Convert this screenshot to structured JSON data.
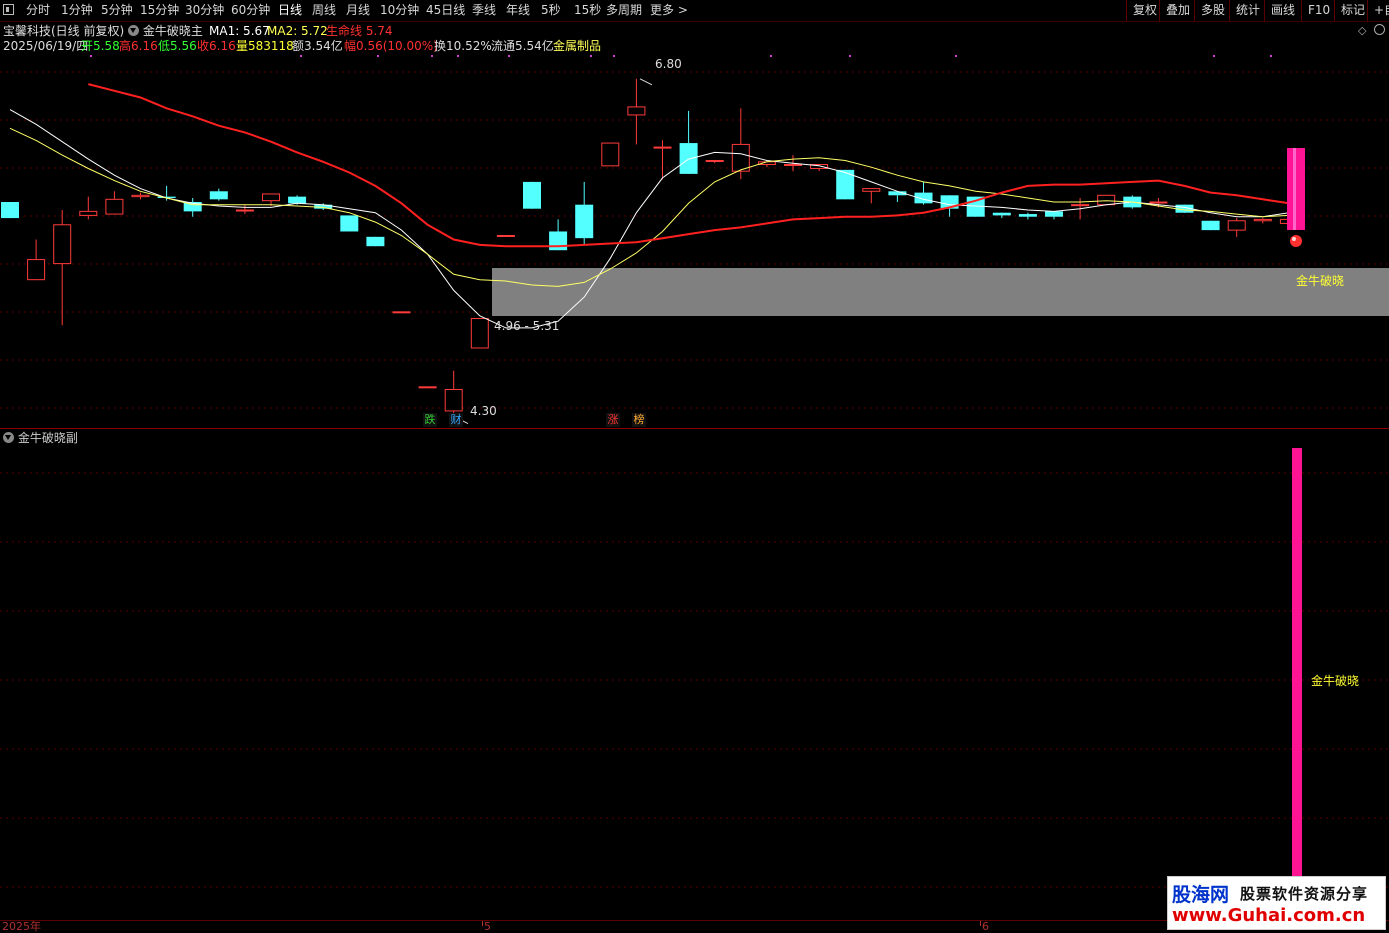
{
  "toolbar": {
    "periods": [
      "分时",
      "1分钟",
      "5分钟",
      "15分钟",
      "30分钟",
      "60分钟",
      "日线",
      "周线",
      "月线",
      "10分钟",
      "45日线",
      "季线",
      "年线",
      "5秒",
      "15秒",
      "多周期",
      "更多 >"
    ],
    "active_period": "日线",
    "right_tools": [
      "复权",
      "叠加",
      "多股",
      "统计",
      "画线",
      "F10",
      "标记",
      "+自"
    ]
  },
  "header": {
    "stock_name": "宝馨科技",
    "mode": "(日线 前复权)",
    "formula_name": "金牛破晓主",
    "ma1_label": "MA1: 5.67",
    "ma2_label": "MA2: 5.72",
    "life_line_label": "生命线  5.74"
  },
  "quote": {
    "date": "2025/06/19/四",
    "open": "开5.58",
    "high": "高6.16",
    "low": "低5.56",
    "close": "收6.16",
    "volume": "量583118",
    "amount": "额3.54亿",
    "change": "幅0.56(10.00%)",
    "turnover": "换10.52%",
    "float": "流通5.54亿",
    "industry": "金属制品"
  },
  "annotations": {
    "high_price": "6.80",
    "low_price": "4.30",
    "zone_range": "4.96 - 5.31",
    "signal_label": "金牛破晓",
    "sub_signal_label": "金牛破晓"
  },
  "signals": [
    {
      "text": "跌",
      "color": "#33cc33"
    },
    {
      "text": "财",
      "color": "#33aaff"
    },
    {
      "text": "涨",
      "color": "#ff3333"
    },
    {
      "text": "榜",
      "color": "#ffaa33"
    }
  ],
  "sub_panel": {
    "title": "金牛破晓副"
  },
  "time_axis": {
    "labels": [
      "2025年",
      "5",
      "6"
    ]
  },
  "watermark": {
    "logo": "股海网",
    "slogan": "股票软件资源分享",
    "url": "www.Guhai.com.cn"
  },
  "colors": {
    "up": "#ff3b3b",
    "down": "#54ffff",
    "ma_white": "#ffffff",
    "ma_yellow": "#ffff66",
    "life_line": "#ff2020",
    "signal_magenta": "#ff1493"
  },
  "chart_data": {
    "type": "candlestick",
    "ylim": [
      4.2,
      7.0
    ],
    "candles": [
      {
        "o": 5.88,
        "h": 5.88,
        "l": 5.76,
        "c": 5.76
      },
      {
        "o": 5.3,
        "h": 5.6,
        "l": 5.3,
        "c": 5.45
      },
      {
        "o": 5.42,
        "h": 5.82,
        "l": 4.96,
        "c": 5.71
      },
      {
        "o": 5.78,
        "h": 5.92,
        "l": 5.75,
        "c": 5.81
      },
      {
        "o": 5.79,
        "h": 5.96,
        "l": 5.79,
        "c": 5.9
      },
      {
        "o": 5.92,
        "h": 5.95,
        "l": 5.9,
        "c": 5.93
      },
      {
        "o": 5.92,
        "h": 6.0,
        "l": 5.89,
        "c": 5.91
      },
      {
        "o": 5.88,
        "h": 5.91,
        "l": 5.77,
        "c": 5.81
      },
      {
        "o": 5.96,
        "h": 5.98,
        "l": 5.89,
        "c": 5.9
      },
      {
        "o": 5.82,
        "h": 5.86,
        "l": 5.79,
        "c": 5.82
      },
      {
        "o": 5.89,
        "h": 5.94,
        "l": 5.85,
        "c": 5.94
      },
      {
        "o": 5.92,
        "h": 5.93,
        "l": 5.86,
        "c": 5.87
      },
      {
        "o": 5.86,
        "h": 5.87,
        "l": 5.82,
        "c": 5.83
      },
      {
        "o": 5.78,
        "h": 5.78,
        "l": 5.66,
        "c": 5.66
      },
      {
        "o": 5.62,
        "h": 5.62,
        "l": 5.55,
        "c": 5.55
      },
      {
        "o": 5.06,
        "h": 5.06,
        "l": 5.06,
        "c": 5.06
      },
      {
        "o": 4.5,
        "h": 4.5,
        "l": 4.5,
        "c": 4.5
      },
      {
        "o": 4.32,
        "h": 4.62,
        "l": 4.3,
        "c": 4.48
      },
      {
        "o": 4.79,
        "h": 5.01,
        "l": 4.79,
        "c": 5.01
      },
      {
        "o": 5.63,
        "h": 5.63,
        "l": 5.63,
        "c": 5.63
      },
      {
        "o": 6.03,
        "h": 6.03,
        "l": 5.83,
        "c": 5.83
      },
      {
        "o": 5.66,
        "h": 5.75,
        "l": 5.52,
        "c": 5.52
      },
      {
        "o": 5.86,
        "h": 6.03,
        "l": 5.56,
        "c": 5.61
      },
      {
        "o": 6.15,
        "h": 6.32,
        "l": 6.15,
        "c": 6.32
      },
      {
        "o": 6.53,
        "h": 6.8,
        "l": 6.31,
        "c": 6.59
      },
      {
        "o": 6.29,
        "h": 6.34,
        "l": 6.05,
        "c": 6.29
      },
      {
        "o": 6.32,
        "h": 6.56,
        "l": 6.2,
        "c": 6.09
      },
      {
        "o": 6.19,
        "h": 6.19,
        "l": 6.17,
        "c": 6.19
      },
      {
        "o": 6.11,
        "h": 6.58,
        "l": 6.05,
        "c": 6.31
      },
      {
        "o": 6.16,
        "h": 6.15,
        "l": 6.14,
        "c": 6.18
      },
      {
        "o": 6.16,
        "h": 6.23,
        "l": 6.11,
        "c": 6.16
      },
      {
        "o": 6.13,
        "h": 6.15,
        "l": 6.11,
        "c": 6.16
      },
      {
        "o": 6.12,
        "h": 6.12,
        "l": 5.9,
        "c": 5.9
      },
      {
        "o": 5.96,
        "h": 5.96,
        "l": 5.87,
        "c": 5.98
      },
      {
        "o": 5.96,
        "h": 5.96,
        "l": 5.88,
        "c": 5.93
      },
      {
        "o": 5.95,
        "h": 6.03,
        "l": 5.86,
        "c": 5.87
      },
      {
        "o": 5.93,
        "h": 5.93,
        "l": 5.77,
        "c": 5.83
      },
      {
        "o": 5.92,
        "h": 5.92,
        "l": 5.77,
        "c": 5.77
      },
      {
        "o": 5.8,
        "h": 5.8,
        "l": 5.76,
        "c": 5.78
      },
      {
        "o": 5.79,
        "h": 5.8,
        "l": 5.75,
        "c": 5.77
      },
      {
        "o": 5.81,
        "h": 5.81,
        "l": 5.75,
        "c": 5.77
      },
      {
        "o": 5.86,
        "h": 5.91,
        "l": 5.75,
        "c": 5.86
      },
      {
        "o": 5.86,
        "h": 5.93,
        "l": 5.88,
        "c": 5.93
      },
      {
        "o": 5.92,
        "h": 5.93,
        "l": 5.83,
        "c": 5.84
      },
      {
        "o": 5.88,
        "h": 5.91,
        "l": 5.84,
        "c": 5.88
      },
      {
        "o": 5.86,
        "h": 5.86,
        "l": 5.8,
        "c": 5.8
      },
      {
        "o": 5.74,
        "h": 5.74,
        "l": 5.67,
        "c": 5.67
      },
      {
        "o": 5.67,
        "h": 5.76,
        "l": 5.62,
        "c": 5.74
      },
      {
        "o": 5.74,
        "h": 5.76,
        "l": 5.72,
        "c": 5.75
      },
      {
        "o": 5.72,
        "h": 5.77,
        "l": 5.7,
        "c": 5.75
      }
    ],
    "ma_white": [
      6.57,
      6.46,
      6.33,
      6.2,
      6.08,
      5.98,
      5.91,
      5.87,
      5.85,
      5.84,
      5.84,
      5.87,
      5.86,
      5.83,
      5.8,
      5.67,
      5.49,
      5.22,
      5.03,
      4.94,
      4.94,
      4.99,
      5.17,
      5.46,
      5.8,
      6.06,
      6.2,
      6.25,
      6.24,
      6.19,
      6.17,
      6.15,
      6.1,
      6.03,
      5.96,
      5.9,
      5.86,
      5.85,
      5.84,
      5.82,
      5.81,
      5.83,
      5.86,
      5.88,
      5.86,
      5.84,
      5.8,
      5.77,
      5.77,
      5.8
    ],
    "ma_yellow": [
      6.43,
      6.34,
      6.23,
      6.13,
      6.04,
      5.96,
      5.91,
      5.86,
      5.86,
      5.86,
      5.86,
      5.85,
      5.84,
      5.8,
      5.73,
      5.63,
      5.49,
      5.34,
      5.3,
      5.29,
      5.26,
      5.25,
      5.28,
      5.38,
      5.5,
      5.66,
      5.87,
      6.03,
      6.12,
      6.18,
      6.2,
      6.21,
      6.19,
      6.14,
      6.08,
      6.03,
      6.0,
      5.96,
      5.94,
      5.91,
      5.88,
      5.88,
      5.89,
      5.88,
      5.85,
      5.82,
      5.81,
      5.79,
      5.77,
      5.78
    ],
    "life_line": [
      6.87,
      6.83,
      6.8,
      6.76,
      6.71,
      6.66,
      6.58,
      6.52,
      6.45,
      6.4,
      6.33,
      6.25,
      6.18,
      6.1,
      6.0,
      5.87,
      5.71,
      5.6,
      5.56,
      5.55,
      5.55,
      5.55,
      5.56,
      5.57,
      5.58,
      5.61,
      5.64,
      5.67,
      5.69,
      5.72,
      5.75,
      5.76,
      5.77,
      5.77,
      5.78,
      5.8,
      5.84,
      5.89,
      5.95,
      6.0,
      6.01,
      6.01,
      6.02,
      6.03,
      6.04,
      6.0,
      5.95,
      5.93,
      5.9,
      5.87
    ]
  }
}
